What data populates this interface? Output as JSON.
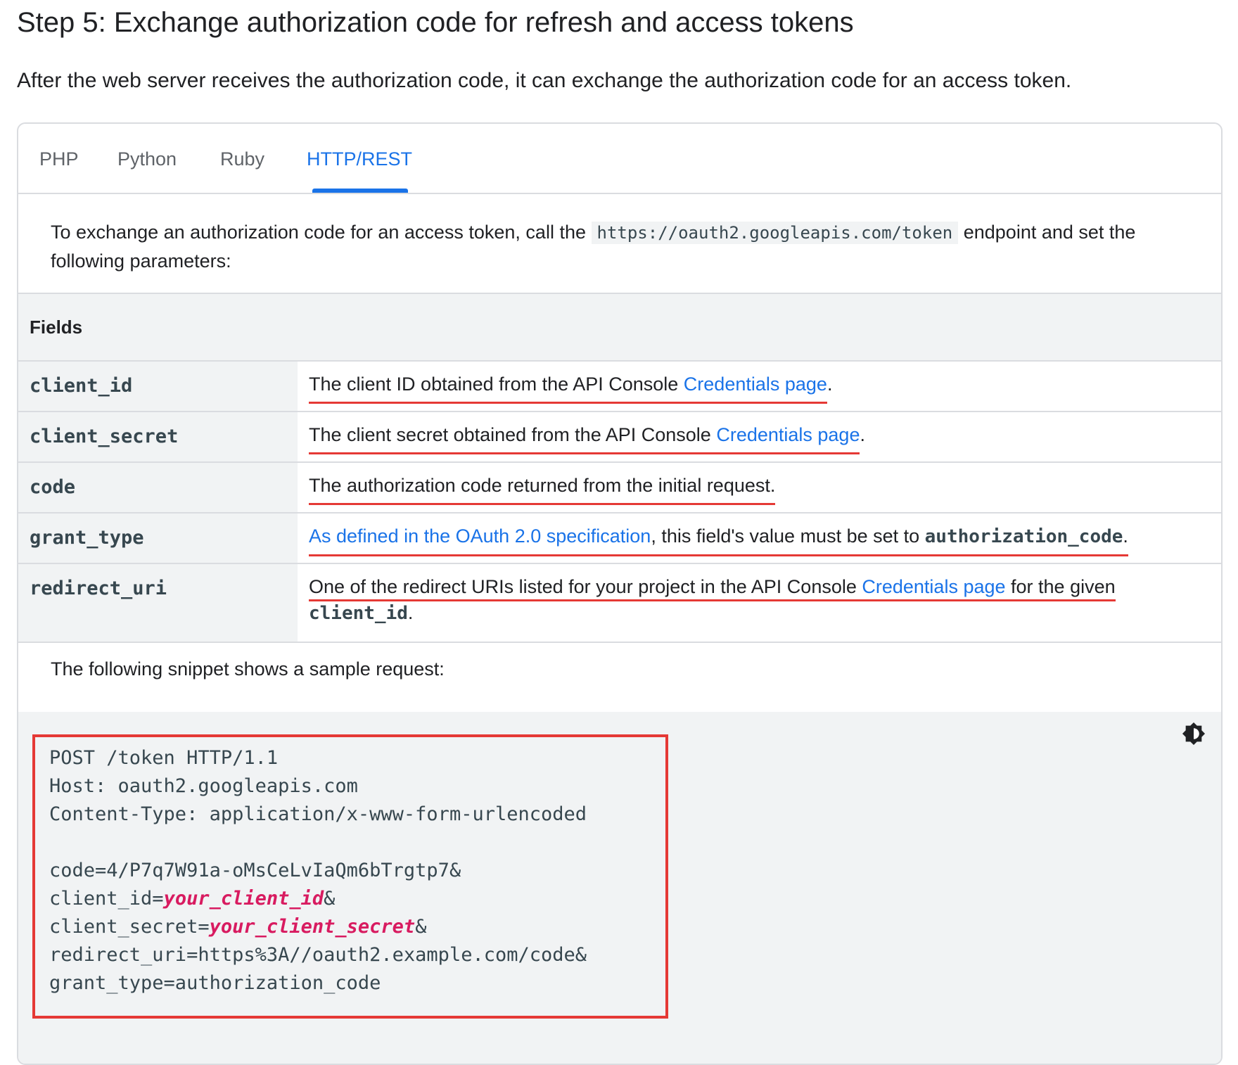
{
  "heading": "Step 5: Exchange authorization code for refresh and access tokens",
  "lead": "After the web server receives the authorization code, it can exchange the authorization code for an access token.",
  "tabs": [
    {
      "label": "PHP"
    },
    {
      "label": "Python"
    },
    {
      "label": "Ruby"
    },
    {
      "label": "HTTP/REST",
      "active": true
    }
  ],
  "intro": {
    "before": "To exchange an authorization code for an access token, call the ",
    "endpoint": "https://oauth2.googleapis.com/token",
    "after": " endpoint and set the following parameters:"
  },
  "fields_header": "Fields",
  "fields": {
    "client_id": {
      "name": "client_id",
      "text": "The client ID obtained from the API Console ",
      "link": "Credentials page",
      "end": "."
    },
    "client_secret": {
      "name": "client_secret",
      "text": "The client secret obtained from the API Console ",
      "link": "Credentials page",
      "end": "."
    },
    "code": {
      "name": "code",
      "text": "The authorization code returned from the initial request."
    },
    "grant_type": {
      "name": "grant_type",
      "link": "As defined in the OAuth 2.0 specification",
      "text": ", this field's value must be set to ",
      "value": "authorization_code",
      "end": "."
    },
    "redirect_uri": {
      "name": "redirect_uri",
      "text": "One of the redirect URIs listed for your project in the API Console ",
      "link": "Credentials page",
      "text2": " for the given",
      "value": "client_id",
      "end": "."
    }
  },
  "snippet_intro": "The following snippet shows a sample request:",
  "code": {
    "line1": "POST /token HTTP/1.1",
    "line2": "Host: oauth2.googleapis.com",
    "line3": "Content-Type: application/x-www-form-urlencoded",
    "line4": "code=4/P7q7W91a-oMsCeLvIaQm6bTrgtp7&",
    "line5_pre": "client_id=",
    "line5_var": "your_client_id",
    "line5_post": "&",
    "line6_pre": "client_secret=",
    "line6_var": "your_client_secret",
    "line6_post": "&",
    "line7": "redirect_uri=https%3A//oauth2.example.com/code&",
    "line8": "grant_type=authorization_code"
  },
  "icons": {
    "theme_toggle": "brightness-contrast-icon"
  },
  "colors": {
    "link": "#1a73e8",
    "highlight": "#e53935",
    "variable": "#d81b60"
  }
}
